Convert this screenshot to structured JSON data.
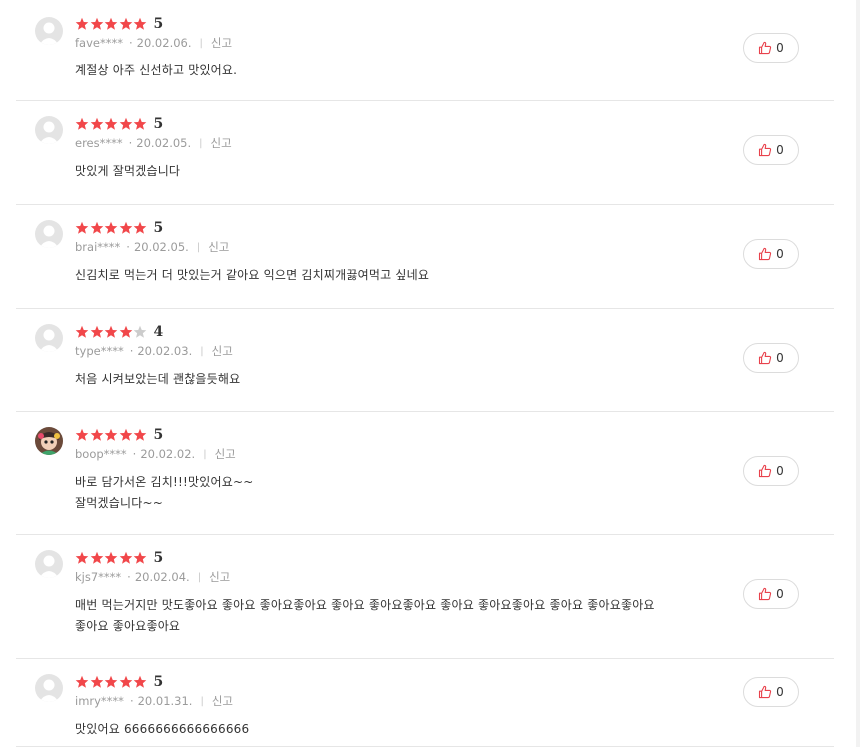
{
  "colors": {
    "star": "#f1474a",
    "star_empty": "#cccccc",
    "like_icon": "#e8424c"
  },
  "reviews": [
    {
      "rating": 5,
      "score": "5",
      "user": "fave****",
      "date": "20.02.06.",
      "report": "신고",
      "text": [
        "계절상 아주 신선하고 맛있어요."
      ],
      "likes": "0",
      "avatar": "default"
    },
    {
      "rating": 5,
      "score": "5",
      "user": "eres****",
      "date": "20.02.05.",
      "report": "신고",
      "text": [
        "맛있게 잘먹겠습니다"
      ],
      "likes": "0",
      "avatar": "default"
    },
    {
      "rating": 5,
      "score": "5",
      "user": "brai****",
      "date": "20.02.05.",
      "report": "신고",
      "text": [
        "신김치로 먹는거 더 맛있는거 같아요 익으면 김치찌개끓여먹고 싶네요"
      ],
      "likes": "0",
      "avatar": "default"
    },
    {
      "rating": 4,
      "score": "4",
      "user": "type****",
      "date": "20.02.03.",
      "report": "신고",
      "text": [
        "처음 시켜보았는데 괜찮을듯해요"
      ],
      "likes": "0",
      "avatar": "default"
    },
    {
      "rating": 5,
      "score": "5",
      "user": "boop****",
      "date": "20.02.02.",
      "report": "신고",
      "text": [
        "바로 담가서온 김치!!!맛있어요~~",
        "잘먹겠습니다~~"
      ],
      "likes": "0",
      "avatar": "photo"
    },
    {
      "rating": 5,
      "score": "5",
      "user": "kjs7****",
      "date": "20.02.04.",
      "report": "신고",
      "text": [
        "매번 먹는거지만 맛도좋아요 좋아요 좋아요좋아요 좋아요 좋아요좋아요 좋아요 좋아요좋아요 좋아요 좋아요좋아요",
        "좋아요 좋아요좋아요"
      ],
      "likes": "0",
      "avatar": "default"
    },
    {
      "rating": 5,
      "score": "5",
      "user": "imry****",
      "date": "20.01.31.",
      "report": "신고",
      "text": [
        "맛있어요 6666666666666666"
      ],
      "likes": "0",
      "avatar": "default"
    }
  ]
}
